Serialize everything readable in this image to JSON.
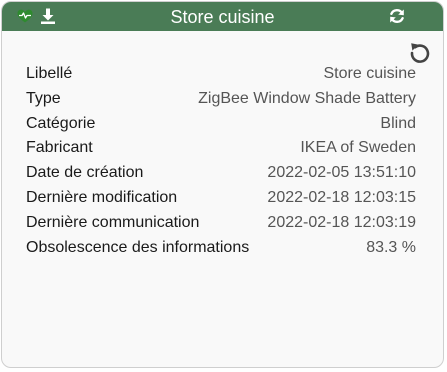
{
  "widget": {
    "title": "Store cuisine",
    "accent_color": "#4a7c56",
    "health_icon": "heart-pulse-icon",
    "health_color": "#2e8b2e",
    "download_icon": "download-icon",
    "refresh_icon": "refresh-icon",
    "reset_icon": "undo-icon"
  },
  "details": [
    {
      "label": "Libellé",
      "value": "Store cuisine"
    },
    {
      "label": "Type",
      "value": "ZigBee Window Shade Battery"
    },
    {
      "label": "Catégorie",
      "value": "Blind"
    },
    {
      "label": "Fabricant",
      "value": "IKEA of Sweden"
    },
    {
      "label": "Date de création",
      "value": "2022-02-05 13:51:10"
    },
    {
      "label": "Dernière modification",
      "value": "2022-02-18 12:03:15"
    },
    {
      "label": "Dernière communication",
      "value": "2022-02-18 12:03:19"
    },
    {
      "label": "Obsolescence des informations",
      "value": "83.3 %"
    }
  ]
}
